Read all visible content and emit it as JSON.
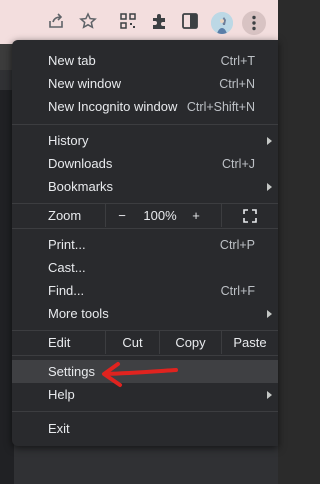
{
  "toolbar": {
    "icons": [
      "share-icon",
      "star-icon",
      "qr-code-icon",
      "extensions-icon",
      "sidebar-icon",
      "avatar",
      "more-icon"
    ]
  },
  "menu": {
    "new_tab": {
      "label": "New tab",
      "shortcut": "Ctrl+T"
    },
    "new_window": {
      "label": "New window",
      "shortcut": "Ctrl+N"
    },
    "new_incognito": {
      "label": "New Incognito window",
      "shortcut": "Ctrl+Shift+N"
    },
    "history": {
      "label": "History"
    },
    "downloads": {
      "label": "Downloads",
      "shortcut": "Ctrl+J"
    },
    "bookmarks": {
      "label": "Bookmarks"
    },
    "zoom": {
      "label": "Zoom",
      "minus": "−",
      "value": "100%",
      "plus": "+"
    },
    "print": {
      "label": "Print...",
      "shortcut": "Ctrl+P"
    },
    "cast": {
      "label": "Cast..."
    },
    "find": {
      "label": "Find...",
      "shortcut": "Ctrl+F"
    },
    "more_tools": {
      "label": "More tools"
    },
    "edit": {
      "label": "Edit",
      "cut": "Cut",
      "copy": "Copy",
      "paste": "Paste"
    },
    "settings": {
      "label": "Settings"
    },
    "help": {
      "label": "Help"
    },
    "exit": {
      "label": "Exit"
    }
  },
  "colors": {
    "menu_bg": "#292a2d",
    "highlight": "#3f4043",
    "annotation_arrow": "#e0231f"
  }
}
